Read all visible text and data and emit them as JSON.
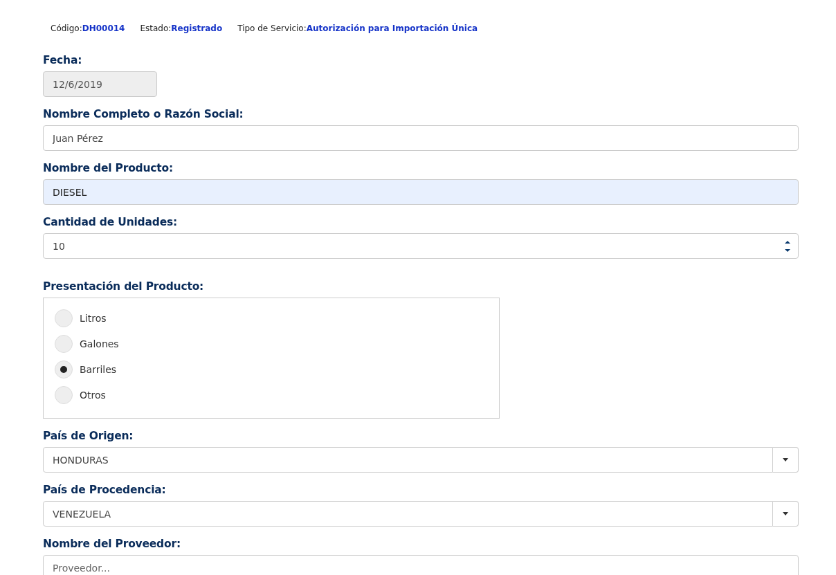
{
  "header": [
    {
      "label": "Código:",
      "value": "DH00014"
    },
    {
      "label": "Estado:",
      "value": "Registrado"
    },
    {
      "label": "Tipo de Servicio:",
      "value": "Autorización para Importación Única"
    }
  ],
  "fields": [
    {
      "kind": "date",
      "label": "Fecha:",
      "value": "12/6/2019",
      "disabled": true
    },
    {
      "kind": "text",
      "label": "Nombre Completo o Razón Social:",
      "value": "Juan Pérez",
      "disabled": false
    },
    {
      "kind": "text",
      "label": "Nombre del Producto:",
      "value": "DIESEL",
      "disabled": false,
      "autofilled": true
    },
    {
      "kind": "number",
      "label": "Cantidad de Unidades:",
      "value": "10"
    },
    {
      "kind": "radios",
      "label": "Presentación del Producto:",
      "options": [
        {
          "label": "Litros",
          "selected": false
        },
        {
          "label": "Galones",
          "selected": false
        },
        {
          "label": "Barriles",
          "selected": true
        },
        {
          "label": "Otros",
          "selected": false
        }
      ]
    },
    {
      "kind": "select",
      "label": "País de Origen:",
      "value": "HONDURAS"
    },
    {
      "kind": "select",
      "label": "País de Procedencia:",
      "value": "VENEZUELA"
    },
    {
      "kind": "text",
      "label": "Nombre del Proveedor:",
      "placeholder": "Proveedor...",
      "disabled": false
    }
  ]
}
